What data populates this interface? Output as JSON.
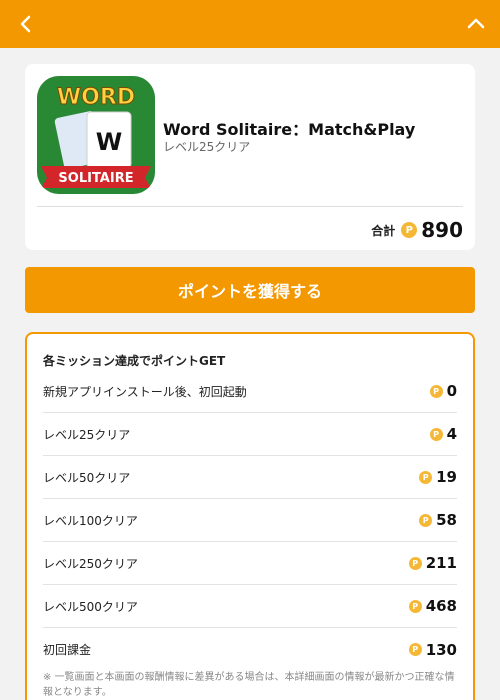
{
  "header": {
    "back_icon": "chevron-left-icon",
    "collapse_icon": "chevron-up-icon",
    "bg_color": "#f39800"
  },
  "app": {
    "name": "Word Solitaire：Match&Play",
    "subtitle": "レベル25クリア",
    "icon_text_top": "WORD",
    "icon_card_letter": "W",
    "icon_text_banner": "SOLITAIRE"
  },
  "total": {
    "label": "合計",
    "coin_glyph": "P",
    "value": "890"
  },
  "cta": {
    "label": "ポイントを獲得する"
  },
  "missions": {
    "title": "各ミッション達成でポイントGET",
    "items": [
      {
        "label": "新規アプリインストール後、初回起動",
        "points": "0"
      },
      {
        "label": "レベル25クリア",
        "points": "4"
      },
      {
        "label": "レベル50クリア",
        "points": "19"
      },
      {
        "label": "レベル100クリア",
        "points": "58"
      },
      {
        "label": "レベル250クリア",
        "points": "211"
      },
      {
        "label": "レベル500クリア",
        "points": "468"
      },
      {
        "label": "初回課金",
        "points": "130"
      }
    ],
    "note": "※ 一覧画面と本画面の報酬情報に差異がある場合は、本詳細画面の情報が最新かつ正確な情報となります。"
  }
}
